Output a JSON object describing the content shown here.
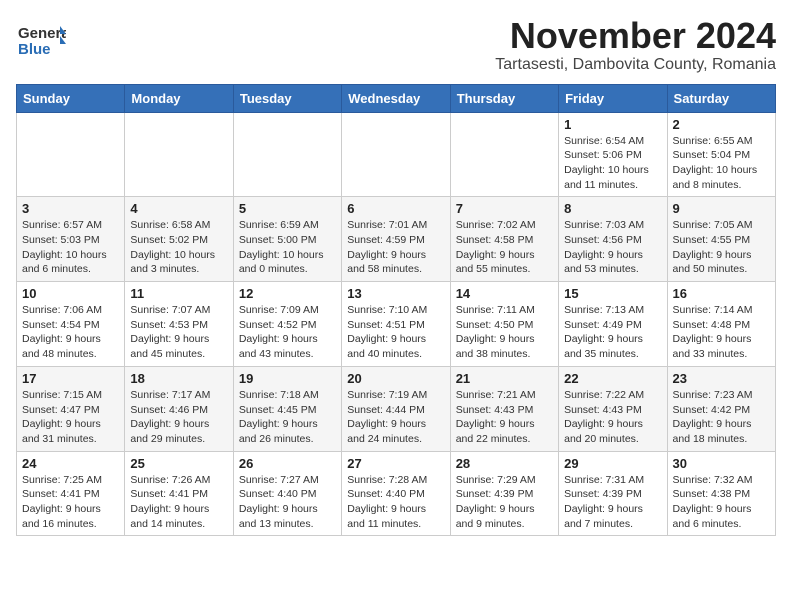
{
  "header": {
    "logo_general": "General",
    "logo_blue": "Blue",
    "month_title": "November 2024",
    "subtitle": "Tartasesti, Dambovita County, Romania"
  },
  "days_of_week": [
    "Sunday",
    "Monday",
    "Tuesday",
    "Wednesday",
    "Thursday",
    "Friday",
    "Saturday"
  ],
  "weeks": [
    [
      {
        "day": "",
        "info": ""
      },
      {
        "day": "",
        "info": ""
      },
      {
        "day": "",
        "info": ""
      },
      {
        "day": "",
        "info": ""
      },
      {
        "day": "",
        "info": ""
      },
      {
        "day": "1",
        "info": "Sunrise: 6:54 AM\nSunset: 5:06 PM\nDaylight: 10 hours and 11 minutes."
      },
      {
        "day": "2",
        "info": "Sunrise: 6:55 AM\nSunset: 5:04 PM\nDaylight: 10 hours and 8 minutes."
      }
    ],
    [
      {
        "day": "3",
        "info": "Sunrise: 6:57 AM\nSunset: 5:03 PM\nDaylight: 10 hours and 6 minutes."
      },
      {
        "day": "4",
        "info": "Sunrise: 6:58 AM\nSunset: 5:02 PM\nDaylight: 10 hours and 3 minutes."
      },
      {
        "day": "5",
        "info": "Sunrise: 6:59 AM\nSunset: 5:00 PM\nDaylight: 10 hours and 0 minutes."
      },
      {
        "day": "6",
        "info": "Sunrise: 7:01 AM\nSunset: 4:59 PM\nDaylight: 9 hours and 58 minutes."
      },
      {
        "day": "7",
        "info": "Sunrise: 7:02 AM\nSunset: 4:58 PM\nDaylight: 9 hours and 55 minutes."
      },
      {
        "day": "8",
        "info": "Sunrise: 7:03 AM\nSunset: 4:56 PM\nDaylight: 9 hours and 53 minutes."
      },
      {
        "day": "9",
        "info": "Sunrise: 7:05 AM\nSunset: 4:55 PM\nDaylight: 9 hours and 50 minutes."
      }
    ],
    [
      {
        "day": "10",
        "info": "Sunrise: 7:06 AM\nSunset: 4:54 PM\nDaylight: 9 hours and 48 minutes."
      },
      {
        "day": "11",
        "info": "Sunrise: 7:07 AM\nSunset: 4:53 PM\nDaylight: 9 hours and 45 minutes."
      },
      {
        "day": "12",
        "info": "Sunrise: 7:09 AM\nSunset: 4:52 PM\nDaylight: 9 hours and 43 minutes."
      },
      {
        "day": "13",
        "info": "Sunrise: 7:10 AM\nSunset: 4:51 PM\nDaylight: 9 hours and 40 minutes."
      },
      {
        "day": "14",
        "info": "Sunrise: 7:11 AM\nSunset: 4:50 PM\nDaylight: 9 hours and 38 minutes."
      },
      {
        "day": "15",
        "info": "Sunrise: 7:13 AM\nSunset: 4:49 PM\nDaylight: 9 hours and 35 minutes."
      },
      {
        "day": "16",
        "info": "Sunrise: 7:14 AM\nSunset: 4:48 PM\nDaylight: 9 hours and 33 minutes."
      }
    ],
    [
      {
        "day": "17",
        "info": "Sunrise: 7:15 AM\nSunset: 4:47 PM\nDaylight: 9 hours and 31 minutes."
      },
      {
        "day": "18",
        "info": "Sunrise: 7:17 AM\nSunset: 4:46 PM\nDaylight: 9 hours and 29 minutes."
      },
      {
        "day": "19",
        "info": "Sunrise: 7:18 AM\nSunset: 4:45 PM\nDaylight: 9 hours and 26 minutes."
      },
      {
        "day": "20",
        "info": "Sunrise: 7:19 AM\nSunset: 4:44 PM\nDaylight: 9 hours and 24 minutes."
      },
      {
        "day": "21",
        "info": "Sunrise: 7:21 AM\nSunset: 4:43 PM\nDaylight: 9 hours and 22 minutes."
      },
      {
        "day": "22",
        "info": "Sunrise: 7:22 AM\nSunset: 4:43 PM\nDaylight: 9 hours and 20 minutes."
      },
      {
        "day": "23",
        "info": "Sunrise: 7:23 AM\nSunset: 4:42 PM\nDaylight: 9 hours and 18 minutes."
      }
    ],
    [
      {
        "day": "24",
        "info": "Sunrise: 7:25 AM\nSunset: 4:41 PM\nDaylight: 9 hours and 16 minutes."
      },
      {
        "day": "25",
        "info": "Sunrise: 7:26 AM\nSunset: 4:41 PM\nDaylight: 9 hours and 14 minutes."
      },
      {
        "day": "26",
        "info": "Sunrise: 7:27 AM\nSunset: 4:40 PM\nDaylight: 9 hours and 13 minutes."
      },
      {
        "day": "27",
        "info": "Sunrise: 7:28 AM\nSunset: 4:40 PM\nDaylight: 9 hours and 11 minutes."
      },
      {
        "day": "28",
        "info": "Sunrise: 7:29 AM\nSunset: 4:39 PM\nDaylight: 9 hours and 9 minutes."
      },
      {
        "day": "29",
        "info": "Sunrise: 7:31 AM\nSunset: 4:39 PM\nDaylight: 9 hours and 7 minutes."
      },
      {
        "day": "30",
        "info": "Sunrise: 7:32 AM\nSunset: 4:38 PM\nDaylight: 9 hours and 6 minutes."
      }
    ]
  ]
}
